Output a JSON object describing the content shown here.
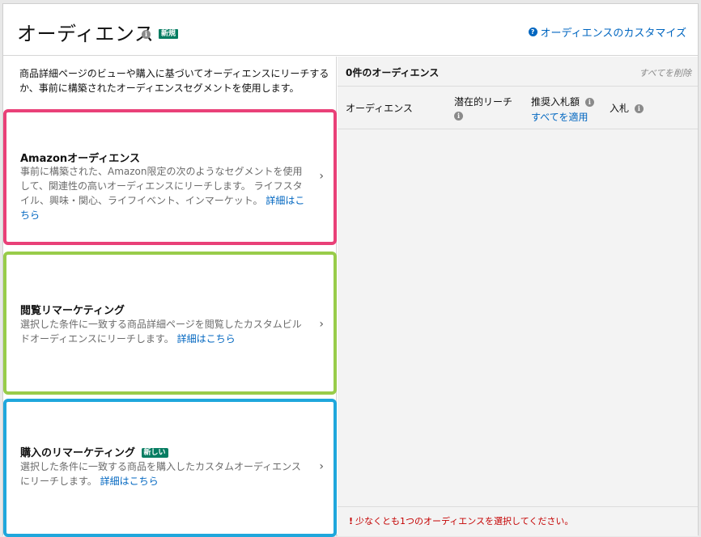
{
  "header": {
    "title": "オーディエンス",
    "badge": "新規",
    "customize_link": "オーディエンスのカスタマイズ",
    "info_icon": "info-icon",
    "help_icon": "help-icon"
  },
  "left": {
    "description": "商品詳細ページのビューや購入に基づいてオーディエンスにリーチするか、事前に構築されたオーディエンスセグメントを使用します。",
    "cards": [
      {
        "title": "Amazonオーディエンス",
        "body": "事前に構築された、Amazon限定の次のようなセグメントを使用して、関連性の高いオーディエンスにリーチします。 ライフスタイル、興味・関心、ライフイベント、インマーケット。",
        "link": "詳細はこちら",
        "border_color": "#e94078"
      },
      {
        "title": "閲覧リマーケティング",
        "body": "選択した条件に一致する商品詳細ページを閲覧したカスタムビルドオーディエンスにリーチします。",
        "link": "詳細はこちら",
        "border_color": "#98cc4a"
      },
      {
        "title": "購入のリマーケティング",
        "badge": "新しい",
        "body": "選択した条件に一致する商品を購入したカスタムオーディエンスにリーチします。",
        "link": "詳細はこちら",
        "border_color": "#1fa7dc"
      }
    ],
    "chevron": "›"
  },
  "right": {
    "count_label": "0件のオーディエンス",
    "clear_all": "すべてを削除",
    "columns": {
      "audience": "オーディエンス",
      "potential_reach": "潜在的リーチ",
      "suggested_bid": "推奨入札額",
      "apply_all": "すべてを適用",
      "bid": "入札"
    },
    "warning": "少なくとも1つのオーディエンスを選択してください。"
  },
  "colors": {
    "accent_link": "#0066c0",
    "badge_green": "#067d62",
    "warning_red": "#c40000"
  }
}
